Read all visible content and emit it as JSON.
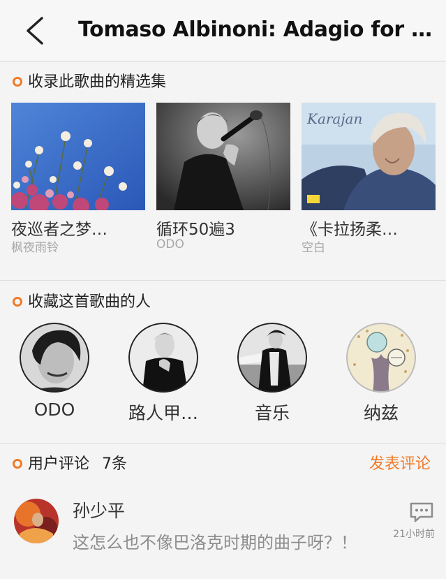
{
  "header": {
    "title": "Tomaso Albinoni: Adagio for S…"
  },
  "collections": {
    "heading": "收录此歌曲的精选集",
    "items": [
      {
        "title": "夜巡者之梦…",
        "subtitle": "枫夜雨铃"
      },
      {
        "title": "循环50遍3",
        "subtitle": "ODO"
      },
      {
        "title": "《卡拉扬柔…",
        "subtitle": "空白",
        "cover_text": "Karajan"
      }
    ]
  },
  "favorites": {
    "heading": "收藏这首歌曲的人",
    "people": [
      {
        "name": "ODO"
      },
      {
        "name": "路人甲…"
      },
      {
        "name": "音乐"
      },
      {
        "name": "纳兹"
      }
    ]
  },
  "comments": {
    "heading": "用户评论",
    "count": "7条",
    "post_label": "发表评论",
    "items": [
      {
        "user": "孙少平",
        "text": "这怎么也不像巴洛克时期的曲子呀？！",
        "time": "21小时前"
      }
    ]
  },
  "colors": {
    "accent": "#f07a27"
  }
}
